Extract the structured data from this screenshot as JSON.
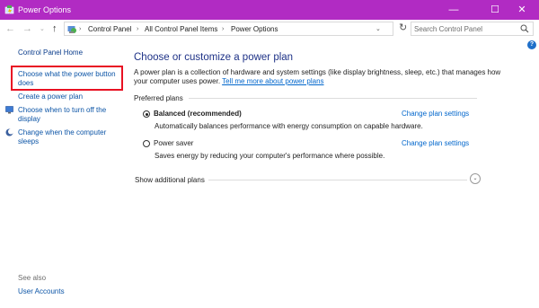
{
  "window": {
    "title": "Power Options",
    "controls": {
      "minimize": "—",
      "maximize": "☐",
      "close": "✕"
    }
  },
  "address": {
    "crumbs": [
      "Control Panel",
      "All Control Panel Items",
      "Power Options"
    ],
    "search_placeholder": "Search Control Panel"
  },
  "sidebar": {
    "home": "Control Panel Home",
    "links": [
      "Choose what the power button does",
      "Create a power plan",
      "Choose when to turn off the display",
      "Change when the computer sleeps"
    ],
    "see_also_label": "See also",
    "see_also_links": [
      "User Accounts"
    ]
  },
  "main": {
    "heading": "Choose or customize a power plan",
    "description": "A power plan is a collection of hardware and system settings (like display brightness, sleep, etc.) that manages how your computer uses power.",
    "description_link": "Tell me more about power plans",
    "group_label": "Preferred plans",
    "plans": [
      {
        "name": "Balanced (recommended)",
        "description": "Automatically balances performance with energy consumption on capable hardware.",
        "selected": true,
        "link": "Change plan settings"
      },
      {
        "name": "Power saver",
        "description": "Saves energy by reducing your computer's performance where possible.",
        "selected": false,
        "link": "Change plan settings"
      }
    ],
    "show_additional": "Show additional plans"
  },
  "colors": {
    "titlebar": "#b12bc3",
    "link": "#0066cc",
    "heading": "#1e3287",
    "highlight": "#e81123"
  }
}
